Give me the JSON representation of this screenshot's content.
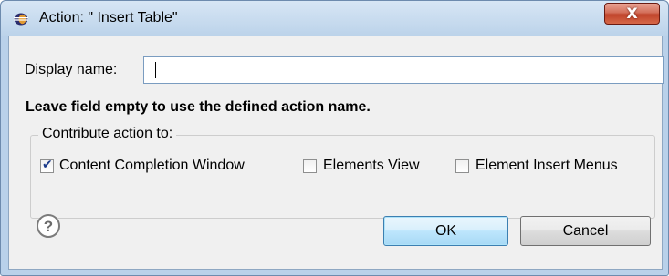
{
  "window": {
    "title": "Action: \" Insert Table\"",
    "close_glyph": "X"
  },
  "form": {
    "display_name_label": "Display name:",
    "display_name_value": "",
    "hint": "Leave field empty to use the defined action name."
  },
  "contribute": {
    "legend": "Contribute action to:",
    "options": [
      {
        "label": "Content Completion Window",
        "checked": true
      },
      {
        "label": "Elements View",
        "checked": false
      },
      {
        "label": "Element Insert Menus",
        "checked": false
      }
    ]
  },
  "buttons": {
    "help_glyph": "?",
    "ok_label": "OK",
    "cancel_label": "Cancel"
  },
  "colors": {
    "frame": "#b9d1ea",
    "client_bg": "#f0f0f0",
    "close_button": "#c0442b",
    "default_button_border": "#3c7fb1"
  }
}
